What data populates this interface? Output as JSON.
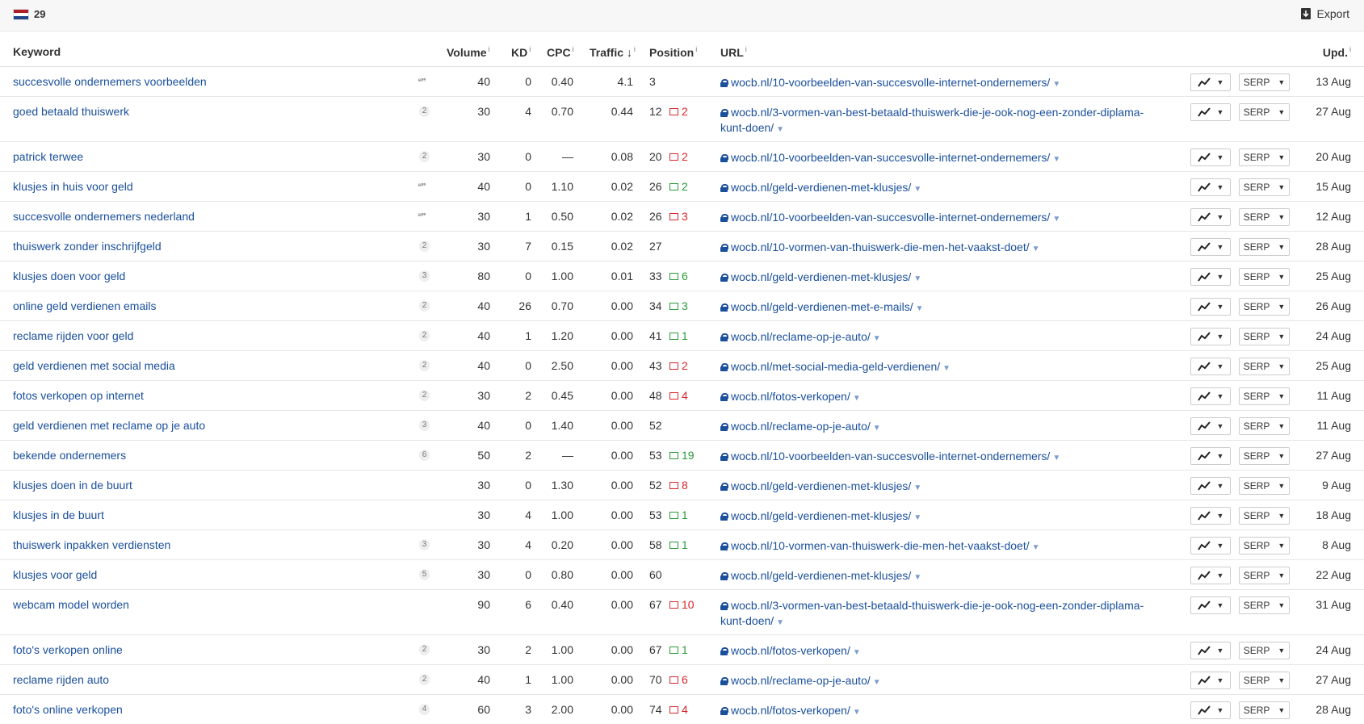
{
  "topbar": {
    "count": "29",
    "export_label": "Export"
  },
  "columns": {
    "keyword": "Keyword",
    "volume": "Volume",
    "kd": "KD",
    "cpc": "CPC",
    "traffic": "Traffic",
    "position": "Position",
    "url": "URL",
    "updated": "Upd.",
    "info": "i",
    "sort_arrow": "↓"
  },
  "buttons": {
    "serp_label": "SERP"
  },
  "rows": [
    {
      "keyword": "succesvolle ondernemers voorbeelden",
      "badge": "",
      "quote": true,
      "volume": "40",
      "kd": "0",
      "cpc": "0.40",
      "traffic": "4.1",
      "position": "3",
      "change": "",
      "dir": "",
      "url": "wocb.nl/10-voorbeelden-van-succesvolle-internet-ondernemers/",
      "updated": "13 Aug"
    },
    {
      "keyword": "goed betaald thuiswerk",
      "badge": "2",
      "quote": false,
      "volume": "30",
      "kd": "4",
      "cpc": "0.70",
      "traffic": "0.44",
      "position": "12",
      "change": "2",
      "dir": "down",
      "url": "wocb.nl/3-vormen-van-best-betaald-thuiswerk-die-je-ook-nog-een-zonder-diplama-kunt-doen/",
      "updated": "27 Aug"
    },
    {
      "keyword": "patrick terwee",
      "badge": "2",
      "quote": false,
      "volume": "30",
      "kd": "0",
      "cpc": "—",
      "traffic": "0.08",
      "position": "20",
      "change": "2",
      "dir": "down",
      "url": "wocb.nl/10-voorbeelden-van-succesvolle-internet-ondernemers/",
      "updated": "20 Aug"
    },
    {
      "keyword": "klusjes in huis voor geld",
      "badge": "",
      "quote": true,
      "volume": "40",
      "kd": "0",
      "cpc": "1.10",
      "traffic": "0.02",
      "position": "26",
      "change": "2",
      "dir": "up",
      "url": "wocb.nl/geld-verdienen-met-klusjes/",
      "updated": "15 Aug"
    },
    {
      "keyword": "succesvolle ondernemers nederland",
      "badge": "",
      "quote": true,
      "volume": "30",
      "kd": "1",
      "cpc": "0.50",
      "traffic": "0.02",
      "position": "26",
      "change": "3",
      "dir": "down",
      "url": "wocb.nl/10-voorbeelden-van-succesvolle-internet-ondernemers/",
      "updated": "12 Aug"
    },
    {
      "keyword": "thuiswerk zonder inschrijfgeld",
      "badge": "2",
      "quote": false,
      "volume": "30",
      "kd": "7",
      "cpc": "0.15",
      "traffic": "0.02",
      "position": "27",
      "change": "",
      "dir": "",
      "url": "wocb.nl/10-vormen-van-thuiswerk-die-men-het-vaakst-doet/",
      "updated": "28 Aug"
    },
    {
      "keyword": "klusjes doen voor geld",
      "badge": "3",
      "quote": false,
      "volume": "80",
      "kd": "0",
      "cpc": "1.00",
      "traffic": "0.01",
      "position": "33",
      "change": "6",
      "dir": "up",
      "url": "wocb.nl/geld-verdienen-met-klusjes/",
      "updated": "25 Aug"
    },
    {
      "keyword": "online geld verdienen emails",
      "badge": "2",
      "quote": false,
      "volume": "40",
      "kd": "26",
      "cpc": "0.70",
      "traffic": "0.00",
      "position": "34",
      "change": "3",
      "dir": "up",
      "url": "wocb.nl/geld-verdienen-met-e-mails/",
      "updated": "26 Aug"
    },
    {
      "keyword": "reclame rijden voor geld",
      "badge": "2",
      "quote": false,
      "volume": "40",
      "kd": "1",
      "cpc": "1.20",
      "traffic": "0.00",
      "position": "41",
      "change": "1",
      "dir": "up",
      "url": "wocb.nl/reclame-op-je-auto/",
      "updated": "24 Aug"
    },
    {
      "keyword": "geld verdienen met social media",
      "badge": "2",
      "quote": false,
      "volume": "40",
      "kd": "0",
      "cpc": "2.50",
      "traffic": "0.00",
      "position": "43",
      "change": "2",
      "dir": "down",
      "url": "wocb.nl/met-social-media-geld-verdienen/",
      "updated": "25 Aug"
    },
    {
      "keyword": "fotos verkopen op internet",
      "badge": "2",
      "quote": false,
      "volume": "30",
      "kd": "2",
      "cpc": "0.45",
      "traffic": "0.00",
      "position": "48",
      "change": "4",
      "dir": "down",
      "url": "wocb.nl/fotos-verkopen/",
      "updated": "11 Aug"
    },
    {
      "keyword": "geld verdienen met reclame op je auto",
      "badge": "3",
      "quote": false,
      "volume": "40",
      "kd": "0",
      "cpc": "1.40",
      "traffic": "0.00",
      "position": "52",
      "change": "",
      "dir": "",
      "url": "wocb.nl/reclame-op-je-auto/",
      "updated": "11 Aug"
    },
    {
      "keyword": "bekende ondernemers",
      "badge": "6",
      "quote": false,
      "volume": "50",
      "kd": "2",
      "cpc": "—",
      "traffic": "0.00",
      "position": "53",
      "change": "19",
      "dir": "up",
      "url": "wocb.nl/10-voorbeelden-van-succesvolle-internet-ondernemers/",
      "updated": "27 Aug"
    },
    {
      "keyword": "klusjes doen in de buurt",
      "badge": "",
      "quote": false,
      "volume": "30",
      "kd": "0",
      "cpc": "1.30",
      "traffic": "0.00",
      "position": "52",
      "change": "8",
      "dir": "down",
      "url": "wocb.nl/geld-verdienen-met-klusjes/",
      "updated": "9 Aug"
    },
    {
      "keyword": "klusjes in de buurt",
      "badge": "",
      "quote": false,
      "volume": "30",
      "kd": "4",
      "cpc": "1.00",
      "traffic": "0.00",
      "position": "53",
      "change": "1",
      "dir": "up",
      "url": "wocb.nl/geld-verdienen-met-klusjes/",
      "updated": "18 Aug"
    },
    {
      "keyword": "thuiswerk inpakken verdiensten",
      "badge": "3",
      "quote": false,
      "volume": "30",
      "kd": "4",
      "cpc": "0.20",
      "traffic": "0.00",
      "position": "58",
      "change": "1",
      "dir": "up",
      "url": "wocb.nl/10-vormen-van-thuiswerk-die-men-het-vaakst-doet/",
      "updated": "8 Aug"
    },
    {
      "keyword": "klusjes voor geld",
      "badge": "5",
      "quote": false,
      "volume": "30",
      "kd": "0",
      "cpc": "0.80",
      "traffic": "0.00",
      "position": "60",
      "change": "",
      "dir": "",
      "url": "wocb.nl/geld-verdienen-met-klusjes/",
      "updated": "22 Aug"
    },
    {
      "keyword": "webcam model worden",
      "badge": "",
      "quote": false,
      "volume": "90",
      "kd": "6",
      "cpc": "0.40",
      "traffic": "0.00",
      "position": "67",
      "change": "10",
      "dir": "down",
      "url": "wocb.nl/3-vormen-van-best-betaald-thuiswerk-die-je-ook-nog-een-zonder-diplama-kunt-doen/",
      "updated": "31 Aug"
    },
    {
      "keyword": "foto's verkopen online",
      "badge": "2",
      "quote": false,
      "volume": "30",
      "kd": "2",
      "cpc": "1.00",
      "traffic": "0.00",
      "position": "67",
      "change": "1",
      "dir": "up",
      "url": "wocb.nl/fotos-verkopen/",
      "updated": "24 Aug"
    },
    {
      "keyword": "reclame rijden auto",
      "badge": "2",
      "quote": false,
      "volume": "40",
      "kd": "1",
      "cpc": "1.00",
      "traffic": "0.00",
      "position": "70",
      "change": "6",
      "dir": "down",
      "url": "wocb.nl/reclame-op-je-auto/",
      "updated": "27 Aug"
    },
    {
      "keyword": "foto's online verkopen",
      "badge": "4",
      "quote": false,
      "volume": "60",
      "kd": "3",
      "cpc": "2.00",
      "traffic": "0.00",
      "position": "74",
      "change": "4",
      "dir": "down",
      "url": "wocb.nl/fotos-verkopen/",
      "updated": "28 Aug"
    }
  ],
  "colors": {
    "link": "#1a4f9c",
    "up": "#2a9a3a",
    "down": "#d9262b"
  },
  "icons": {
    "flag": "netherlands-flag-icon",
    "export": "export-icon",
    "lock": "lock-icon",
    "trend": "trend-chart-icon",
    "quote": "quote-icon"
  }
}
